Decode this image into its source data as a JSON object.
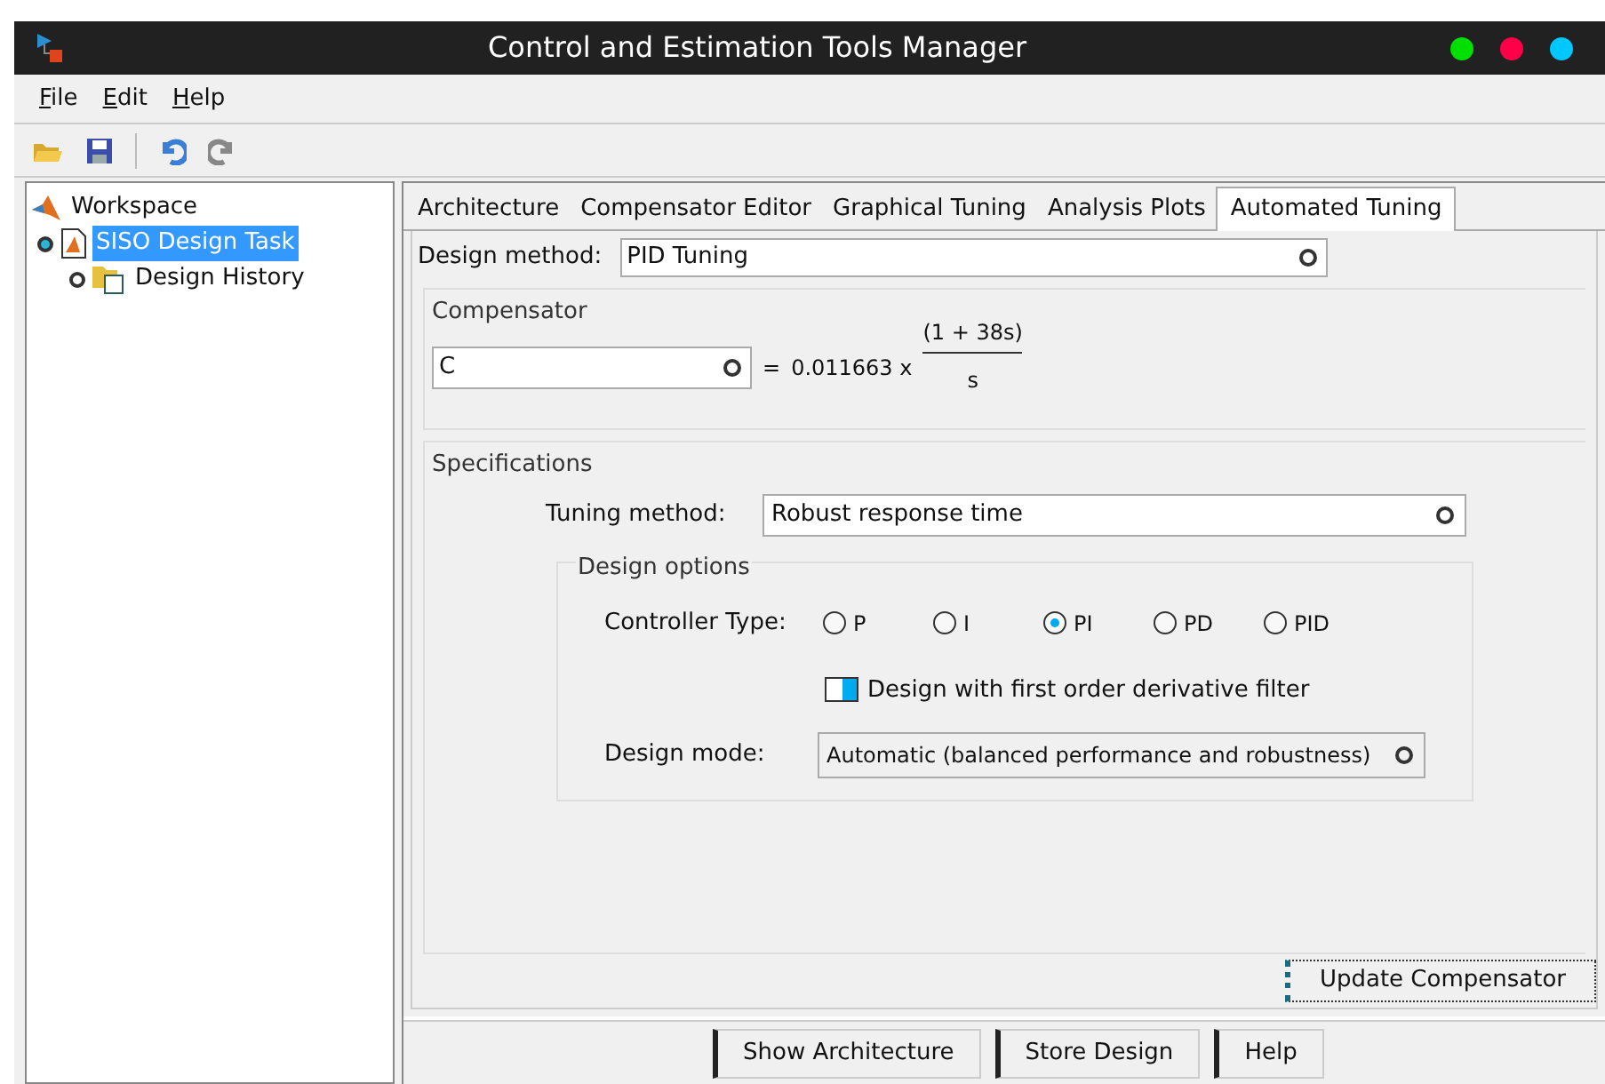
{
  "window": {
    "title": "Control and Estimation Tools Manager"
  },
  "menu": [
    "File",
    "Edit",
    "Help"
  ],
  "tree": [
    {
      "label": "Workspace",
      "selected": false,
      "children": [
        {
          "label": "SISO Design Task",
          "selected": true,
          "children": [
            {
              "label": "Design History",
              "selected": false
            }
          ]
        }
      ]
    }
  ],
  "tabs": [
    {
      "label": "Architecture",
      "selected": false
    },
    {
      "label": "Compensator Editor",
      "selected": false
    },
    {
      "label": "Graphical Tuning",
      "selected": false
    },
    {
      "label": "Analysis Plots",
      "selected": false
    },
    {
      "label": "Automated Tuning",
      "selected": true
    }
  ],
  "design_method": {
    "label": "Design method:",
    "value": "PID Tuning"
  },
  "compensator": {
    "title": "Compensator",
    "value": "C",
    "equals": "=",
    "gain": "0.011663 x",
    "numerator": "(1 + 38s)",
    "denominator": "s"
  },
  "specifications": {
    "title": "Specifications",
    "tuning_method": {
      "label": "Tuning method:",
      "value": "Robust response time"
    },
    "design_options": {
      "title": "Design options",
      "controller_type_label": "Controller Type:",
      "controller_types": [
        {
          "label": "P",
          "selected": false
        },
        {
          "label": "I",
          "selected": false
        },
        {
          "label": "PI",
          "selected": true
        },
        {
          "label": "PD",
          "selected": false
        },
        {
          "label": "PID",
          "selected": false
        }
      ],
      "derivative_filter": {
        "label": "Design with first order derivative filter",
        "checked": false
      },
      "design_mode": {
        "label": "Design mode:",
        "value": "Automatic (balanced performance and robustness)"
      }
    }
  },
  "update_button": "Update Compensator",
  "bottom_buttons": [
    "Show Architecture",
    "Store Design",
    "Help"
  ]
}
